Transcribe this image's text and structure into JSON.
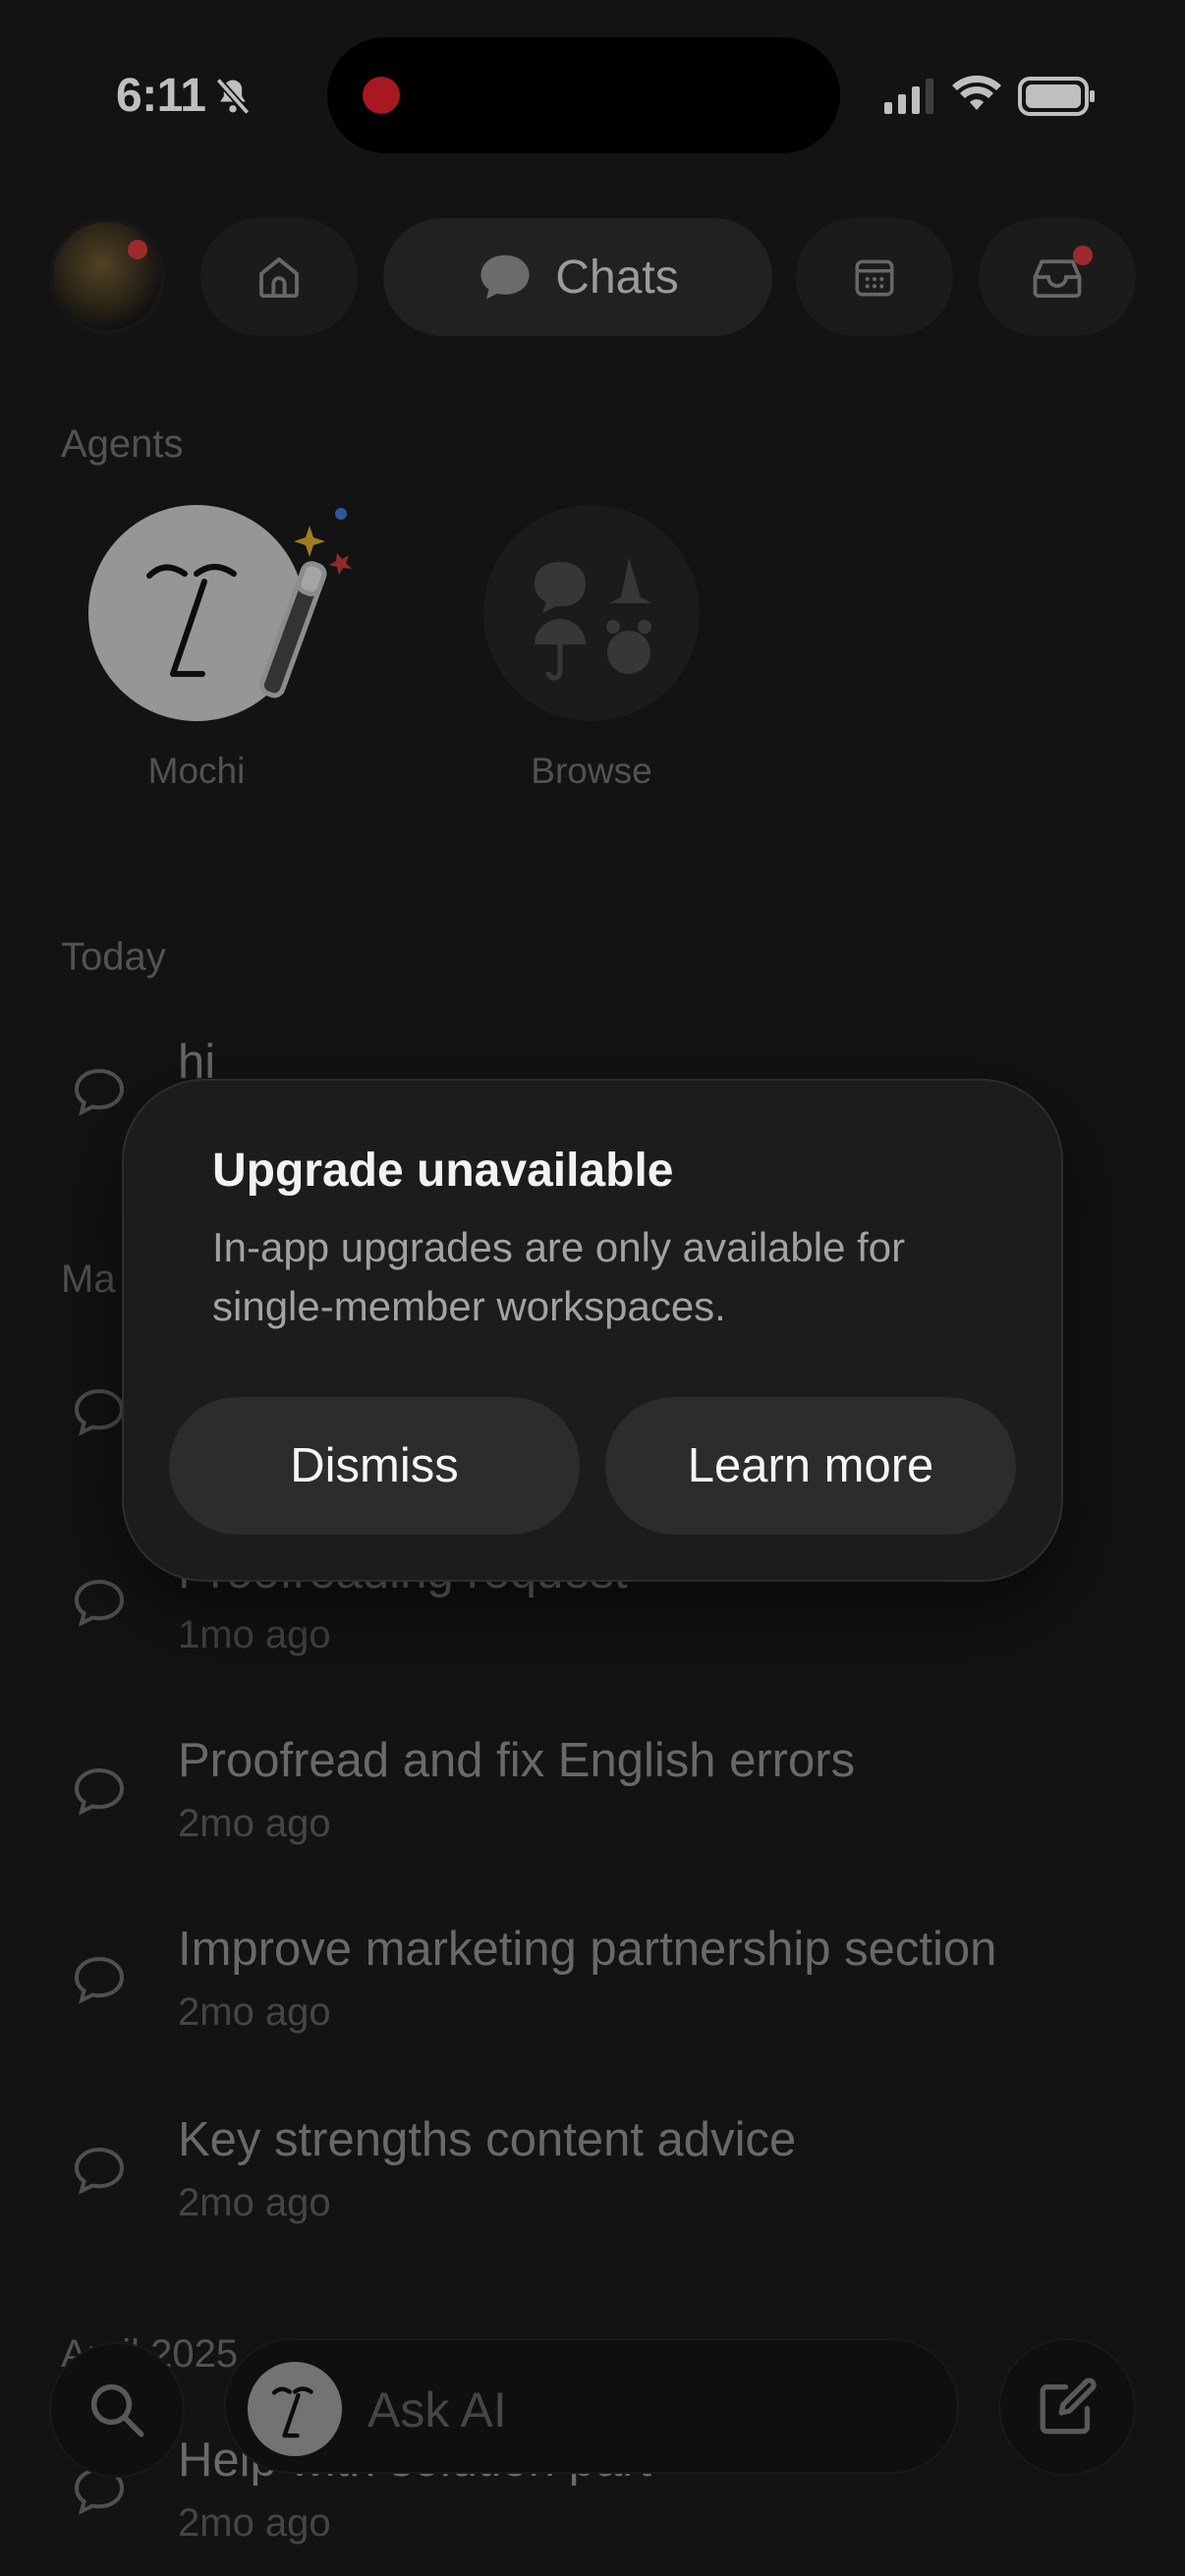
{
  "status_bar": {
    "time": "6:11"
  },
  "nav": {
    "chats_label": "Chats"
  },
  "agents": {
    "section_title": "Agents",
    "items": [
      {
        "label": "Mochi"
      },
      {
        "label": "Browse"
      }
    ]
  },
  "today": {
    "section_title": "Today",
    "chats": [
      {
        "title": "hi"
      }
    ]
  },
  "may": {
    "section_title_partial": "Ma"
  },
  "older_chats": [
    {
      "title": "Proofreading request",
      "time": "1mo ago"
    },
    {
      "title": "Proofread and fix English errors",
      "time": "2mo ago"
    },
    {
      "title": "Improve marketing partnership section",
      "time": "2mo ago"
    },
    {
      "title": "Key strengths content advice",
      "time": "2mo ago"
    }
  ],
  "april": {
    "section_title": "April 2025",
    "chats": [
      {
        "title": "Help with solution part",
        "time": "2mo ago"
      }
    ]
  },
  "bottom_bar": {
    "ask_placeholder": "Ask AI"
  },
  "dialog": {
    "title": "Upgrade unavailable",
    "message": "In-app upgrades are only available for single-member workspaces.",
    "dismiss_label": "Dismiss",
    "learn_more_label": "Learn more"
  },
  "colors": {
    "background": "#1a1a1a",
    "surface": "#242424",
    "accent_red": "#e0202b"
  }
}
